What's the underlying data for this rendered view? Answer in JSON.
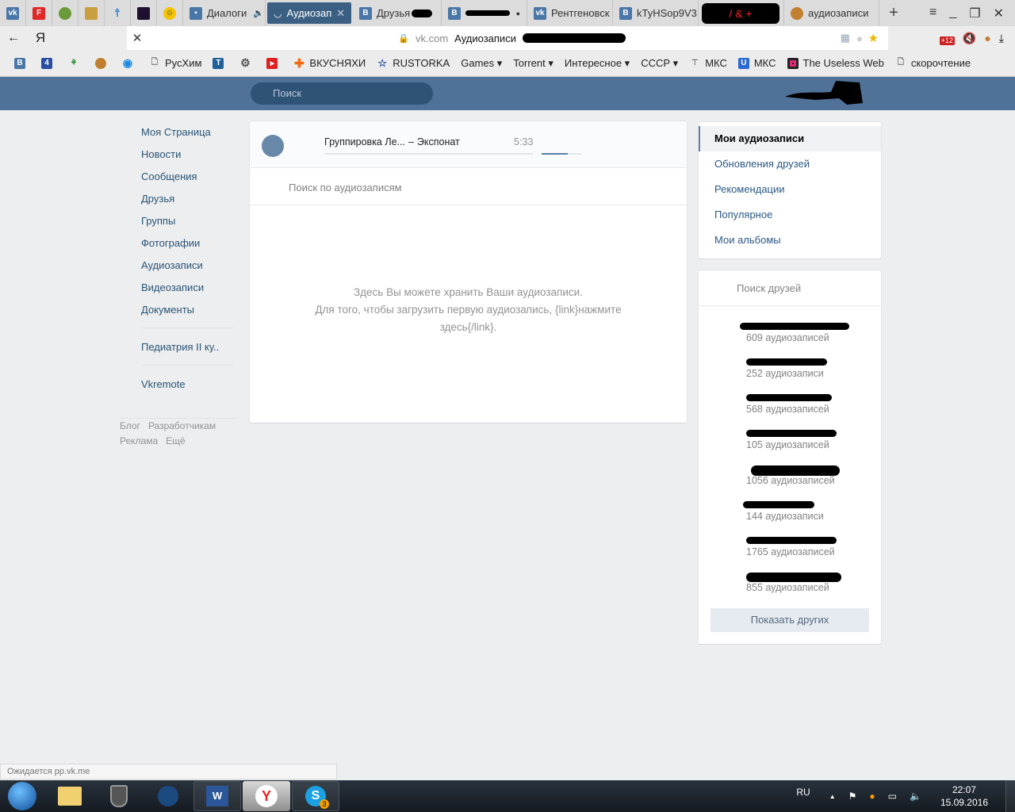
{
  "browser": {
    "tabs": [
      {
        "label": "",
        "icon": "vk-icon",
        "pinned": true,
        "color": "#4a76a8"
      },
      {
        "label": "",
        "icon": "flipboard-icon",
        "pinned": true,
        "color": "#e12828"
      },
      {
        "label": "",
        "icon": "emblem-icon",
        "pinned": true,
        "color": "#6a9a3a"
      },
      {
        "label": "",
        "icon": "emblem-icon",
        "pinned": true,
        "color": "#c8a040"
      },
      {
        "label": "",
        "icon": "runner-icon",
        "pinned": true,
        "color": "#5090d0"
      },
      {
        "label": "",
        "icon": "site-icon",
        "pinned": true,
        "color": "#201030"
      },
      {
        "label": "",
        "icon": "smiley-icon",
        "pinned": true,
        "color": "#f2c400"
      },
      {
        "label": "Диалоги",
        "icon": "message-icon",
        "audio": true
      },
      {
        "label": "Аудиозап",
        "icon": "music-icon",
        "active": true
      },
      {
        "label": "Друзья",
        "icon": "vk-icon"
      },
      {
        "label": "",
        "icon": "vk-icon"
      },
      {
        "label": "Рентгеновск",
        "icon": "vk-icon"
      },
      {
        "label": "kTyHSop9V3",
        "icon": "vk-icon"
      },
      {
        "label": "",
        "icon": "redacted"
      },
      {
        "label": "аудиозаписи",
        "icon": "muffin-icon"
      }
    ],
    "new_tab": "+",
    "back": "←",
    "yandex_logo": "Я",
    "stop": "✕",
    "url_domain": "vk.com",
    "url_title": "Аудиозаписи",
    "downloads_badge": "+12",
    "bookmarks": [
      {
        "label": "",
        "icon": "vk-icon"
      },
      {
        "label": "",
        "icon": "four-icon"
      },
      {
        "label": "",
        "icon": "molecule-icon"
      },
      {
        "label": "",
        "icon": "muffin-icon"
      },
      {
        "label": "",
        "icon": "circle-icon"
      },
      {
        "label": "РусХим",
        "icon": "page-icon"
      },
      {
        "label": "",
        "icon": "t-icon"
      },
      {
        "label": "",
        "icon": "gear-icon"
      },
      {
        "label": "",
        "icon": "youtube-icon"
      },
      {
        "label": "ВКУСНЯХИ",
        "icon": "cross-icon"
      },
      {
        "label": "RUSTORKA",
        "icon": "star-icon"
      },
      {
        "label": "Games ▾",
        "icon": ""
      },
      {
        "label": "Torrent ▾",
        "icon": ""
      },
      {
        "label": "Интересное ▾",
        "icon": ""
      },
      {
        "label": "СССР ▾",
        "icon": ""
      },
      {
        "label": "МКС",
        "icon": "antenna-icon"
      },
      {
        "label": "МКС",
        "icon": "u-icon"
      },
      {
        "label": "The Useless Web",
        "icon": "useless-icon"
      },
      {
        "label": "скорочтение",
        "icon": "page-icon"
      }
    ],
    "bookmarks_more": "»",
    "status": "Ожидается pp.vk.me"
  },
  "vk": {
    "search_placeholder": "Поиск",
    "left_nav": [
      "Моя Страница",
      "Новости",
      "Сообщения",
      "Друзья",
      "Группы",
      "Фотографии",
      "Аудиозаписи",
      "Видеозаписи",
      "Документы"
    ],
    "left_nav_groups": [
      "Педиатрия II ку.."
    ],
    "left_nav_apps": [
      "Vkremote"
    ],
    "footer": [
      "Блог",
      "Разработчикам",
      "Реклама",
      "Ещё"
    ],
    "player": {
      "artist": "Группировка Ле...",
      "separator": "–",
      "title": "Экспонат",
      "duration": "5:33",
      "progress": 0,
      "volume": 0.66
    },
    "audio_search_placeholder": "Поиск по аудиозаписям",
    "empty_line1": "Здесь Вы можете хранить Ваши аудиозаписи.",
    "empty_line2": "Для того, чтобы загрузить первую аудиозапись, {link}нажмите здесь{/link}.",
    "right_menu": [
      {
        "label": "Мои аудиозаписи",
        "selected": true
      },
      {
        "label": "Обновления друзей"
      },
      {
        "label": "Рекомендации"
      },
      {
        "label": "Популярное"
      },
      {
        "label": "Мои альбомы"
      }
    ],
    "friends_search_placeholder": "Поиск друзей",
    "friends": [
      {
        "name": "",
        "count": "609 аудиозаписей"
      },
      {
        "name": "",
        "count": "252 аудиозаписи"
      },
      {
        "name": "",
        "count": "568 аудиозаписей"
      },
      {
        "name": "",
        "count": "105 аудиозаписей"
      },
      {
        "name": "",
        "count": "1056 аудиозаписей"
      },
      {
        "name": "",
        "count": "144 аудиозаписи"
      },
      {
        "name": "",
        "count": "1765 аудиозаписей"
      },
      {
        "name": "",
        "count": "855 аудиозаписей"
      }
    ],
    "show_more": "Показать других"
  },
  "taskbar": {
    "apps": [
      "start",
      "explorer",
      "world-of-tanks",
      "steam",
      "word",
      "yandex-browser",
      "skype"
    ],
    "skype_badge": "3",
    "language": "RU",
    "time": "22:07",
    "date": "15.09.2016"
  }
}
